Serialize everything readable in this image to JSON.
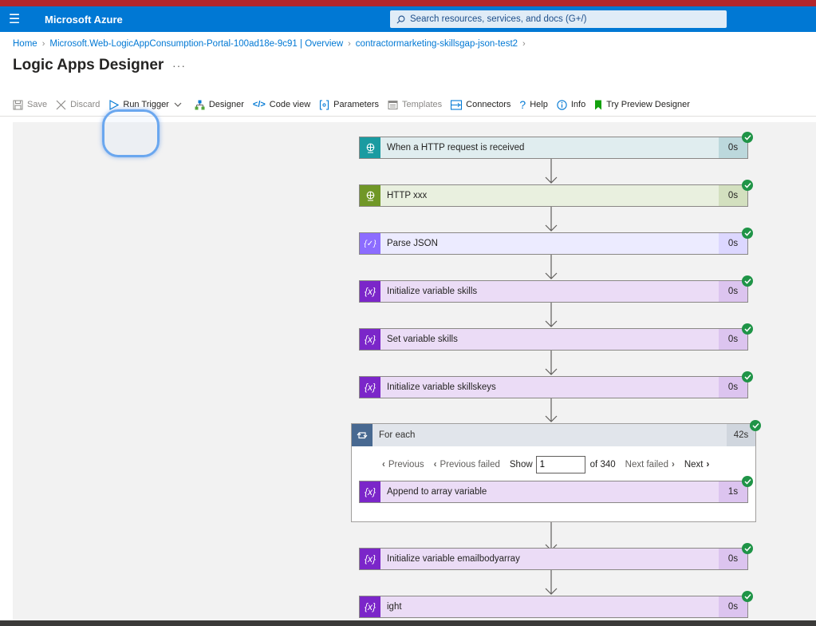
{
  "header": {
    "brand": "Microsoft Azure",
    "search_placeholder": "Search resources, services, and docs (G+/)"
  },
  "breadcrumb": [
    {
      "label": "Home"
    },
    {
      "label": "Microsoft.Web-LogicAppConsumption-Portal-100ad18e-9c91 | Overview"
    },
    {
      "label": "contractormarketing-skillsgap-json-test2"
    }
  ],
  "page": {
    "title": "Logic Apps Designer",
    "more": "···"
  },
  "toolbar": {
    "save": "Save",
    "discard": "Discard",
    "run_trigger": "Run Trigger",
    "designer": "Designer",
    "code_view": "Code view",
    "parameters": "Parameters",
    "templates": "Templates",
    "connectors": "Connectors",
    "help": "Help",
    "info": "Info",
    "try_preview": "Try Preview Designer"
  },
  "steps": [
    {
      "label": "When a HTTP request is received",
      "duration": "0s",
      "icon": "http-request-icon"
    },
    {
      "label": "HTTP xxx",
      "duration": "0s",
      "icon": "http-icon"
    },
    {
      "label": "Parse JSON",
      "duration": "0s",
      "icon": "parse-json-icon"
    },
    {
      "label": "Initialize variable skills",
      "duration": "0s",
      "icon": "variable-icon"
    },
    {
      "label": "Set variable skills",
      "duration": "0s",
      "icon": "variable-icon"
    },
    {
      "label": "Initialize variable skillskeys",
      "duration": "0s",
      "icon": "variable-icon"
    }
  ],
  "foreach": {
    "label": "For each",
    "duration": "42s",
    "pager": {
      "previous": "Previous",
      "previous_failed": "Previous failed",
      "show": "Show",
      "current": "1",
      "of": "of 340",
      "next_failed": "Next failed",
      "next": "Next"
    },
    "inner": {
      "label": "Append to array variable",
      "duration": "1s"
    }
  },
  "after_steps": [
    {
      "label": "Initialize variable emailbodyarray",
      "duration": "0s"
    },
    {
      "label": "ight",
      "duration": "0s"
    }
  ],
  "colors": {
    "azure_blue": "#0078d4",
    "success_green": "#1f9447",
    "variable_purple": "#7b26c9",
    "request_teal": "#1a9ba1",
    "http_green": "#709727",
    "parse_violet": "#8c6cff",
    "foreach_slate": "#486991"
  }
}
